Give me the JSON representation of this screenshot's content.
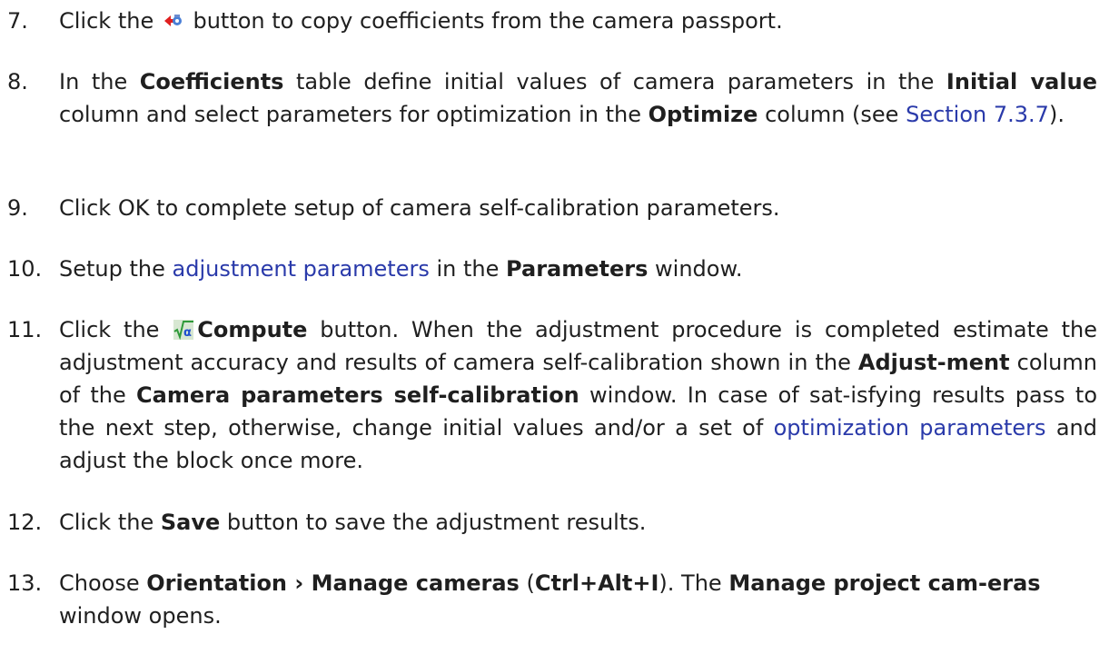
{
  "steps": [
    {
      "num": "7.",
      "parts": [
        "Click the",
        "button to copy coefficients from the camera passport."
      ],
      "icon": "copy-coefficients-icon"
    },
    {
      "num": "8.",
      "parts": [
        "In the",
        "Coefficients",
        "table define initial values of camera parameters in the",
        "Initial value",
        "column and select parameters for optimization in the",
        "Optimize",
        "column (see",
        "Section 7.3.7",
        ")."
      ]
    },
    {
      "num": "9.",
      "parts": [
        "Click OK to complete setup of camera self-calibration parameters."
      ]
    },
    {
      "num": "10.",
      "parts": [
        "Setup the",
        "adjustment parameters",
        "in the",
        "Parameters",
        "window."
      ]
    },
    {
      "num": "11.",
      "parts": [
        "Click the",
        "Compute",
        "button. When the adjustment procedure is completed estimate the adjustment accuracy and results of camera self-calibration shown in the",
        "Adjust-ment",
        "column of the",
        "Camera parameters self-calibration",
        "window. In case of sat-isfying results pass to the next step, otherwise, change initial values and/or a set of",
        "optimization parameters",
        "and adjust the block once more."
      ],
      "icon": "compute-sqrt-alpha-icon"
    },
    {
      "num": "12.",
      "parts": [
        "Click the",
        "Save",
        "button to save the adjustment results."
      ]
    },
    {
      "num": "13.",
      "parts": [
        "Choose",
        "Orientation › Manage cameras",
        "(",
        "Ctrl+Alt+I",
        "). The",
        "Manage project cam-eras",
        "window opens."
      ]
    }
  ],
  "colors": {
    "text": "#1f1f1f",
    "link": "#2a3aaa"
  }
}
